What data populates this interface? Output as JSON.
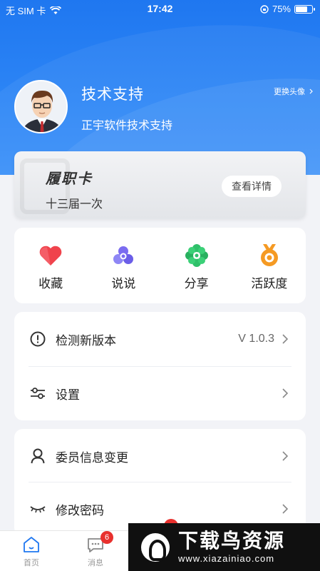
{
  "status_bar": {
    "carrier": "无 SIM 卡",
    "time": "17:42",
    "battery": "75%",
    "battery_level": 0.75
  },
  "profile": {
    "name": "技术支持",
    "description": "正宇软件技术支持",
    "change_avatar_label": "更换头像"
  },
  "card": {
    "title": "履职卡",
    "subtitle": "十三届一次",
    "details_button": "查看详情"
  },
  "quick_actions": [
    {
      "label": "收藏",
      "icon": "heart-icon",
      "color": "#f0434c"
    },
    {
      "label": "说说",
      "icon": "chat-bubbles-icon",
      "color": "#7b6cf0"
    },
    {
      "label": "分享",
      "icon": "share-flower-icon",
      "color": "#2fc06a"
    },
    {
      "label": "活跃度",
      "icon": "medal-icon",
      "color": "#f59a23"
    }
  ],
  "menu_group_1": [
    {
      "label": "检测新版本",
      "value": "V 1.0.3",
      "icon": "info-circle-icon"
    },
    {
      "label": "设置",
      "value": "",
      "icon": "sliders-icon"
    }
  ],
  "menu_group_2": [
    {
      "label": "委员信息变更",
      "icon": "user-icon"
    },
    {
      "label": "修改密码",
      "icon": "eye-closed-icon"
    }
  ],
  "tab_bar": {
    "home_label": "首页",
    "messages_label": "消息",
    "messages_badge": "6"
  },
  "watermark": {
    "title": "下载鸟资源",
    "url": "www.xiazainiao.com"
  },
  "colors": {
    "header_blue": "#1f77f0",
    "badge_red": "#e8302d"
  }
}
